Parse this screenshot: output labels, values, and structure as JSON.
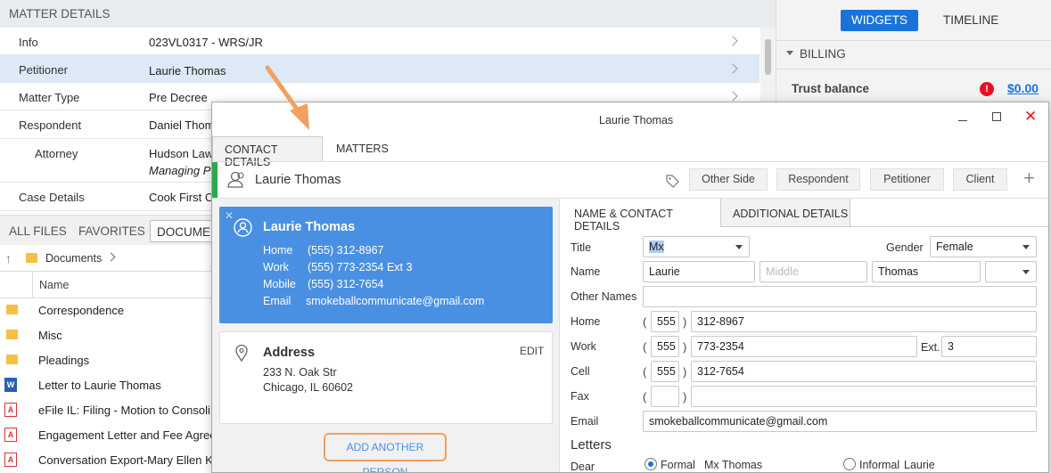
{
  "matter": {
    "header": "MATTER DETAILS",
    "rows": [
      {
        "key": "Info",
        "value": "023VL0317 - WRS/JR"
      },
      {
        "key": "Petitioner",
        "value": "Laurie Thomas"
      },
      {
        "key": "Matter Type",
        "value": "Pre Decree"
      },
      {
        "key": "Respondent",
        "value": "Daniel Thom"
      },
      {
        "key": "Attorney",
        "value": "Hudson Law",
        "sub": "Managing P"
      },
      {
        "key": "Case Details",
        "value": "Cook First C"
      }
    ]
  },
  "files": {
    "tabs": [
      "ALL FILES",
      "FAVORITES",
      "DOCUMEN"
    ],
    "breadcrumb": "Documents",
    "column": "Name",
    "items": [
      "Correspondence",
      "Misc",
      "Pleadings",
      "Letter to Laurie Thomas",
      "eFile IL: Filing - Motion to Consoli",
      "Engagement Letter and Fee Agree",
      "Conversation Export-Mary Ellen Ke"
    ]
  },
  "right_panel": {
    "tabs": [
      "WIDGETS",
      "TIMELINE"
    ],
    "section": "BILLING",
    "trust_label": "Trust balance",
    "trust_value": "$0.00"
  },
  "dialog": {
    "title": "Laurie Thomas",
    "tabs": [
      "CONTACT DETAILS",
      "MATTERS"
    ],
    "contact_name": "Laurie Thomas",
    "roles": [
      "Other Side",
      "Respondent",
      "Petitioner",
      "Client"
    ],
    "card": {
      "name": "Laurie Thomas",
      "lines": [
        {
          "label": "Home",
          "value": "(555) 312-8967"
        },
        {
          "label": "Work",
          "value": "(555) 773-2354 Ext 3"
        },
        {
          "label": "Mobile",
          "value": "(555) 312-7654"
        },
        {
          "label": "Email",
          "value": "smokeballcommunicate@gmail.com"
        }
      ]
    },
    "address": {
      "title": "Address",
      "edit": "EDIT",
      "line1": "233 N. Oak Str",
      "line2": "Chicago, IL 60602"
    },
    "add_person": "ADD ANOTHER PERSON",
    "form_tabs": [
      "NAME & CONTACT DETAILS",
      "ADDITIONAL DETAILS"
    ],
    "form": {
      "title_label": "Title",
      "title_value": "Mx",
      "gender_label": "Gender",
      "gender_value": "Female",
      "name_label": "Name",
      "first": "Laurie",
      "middle_placeholder": "Middle",
      "last": "Thomas",
      "other_names_label": "Other Names",
      "home_label": "Home",
      "home_area": "555",
      "home_number": "312-8967",
      "work_label": "Work",
      "work_area": "555",
      "work_number": "773-2354",
      "ext_label": "Ext.",
      "ext_value": "3",
      "cell_label": "Cell",
      "cell_area": "555",
      "cell_number": "312-7654",
      "fax_label": "Fax",
      "email_label": "Email",
      "email_value": "smokeballcommunicate@gmail.com",
      "letters_label": "Letters",
      "dear_label": "Dear",
      "formal_label": "Formal",
      "formal_value": "Mx Thomas",
      "informal_label": "Informal",
      "informal_value": "Laurie"
    }
  },
  "colors": {
    "accent": "#1a73d9",
    "card": "#4a90e2",
    "highlight": "#dde9f6",
    "warning": "#e81123",
    "callout": "#f0a060",
    "role_bar": "#2ea84f"
  }
}
